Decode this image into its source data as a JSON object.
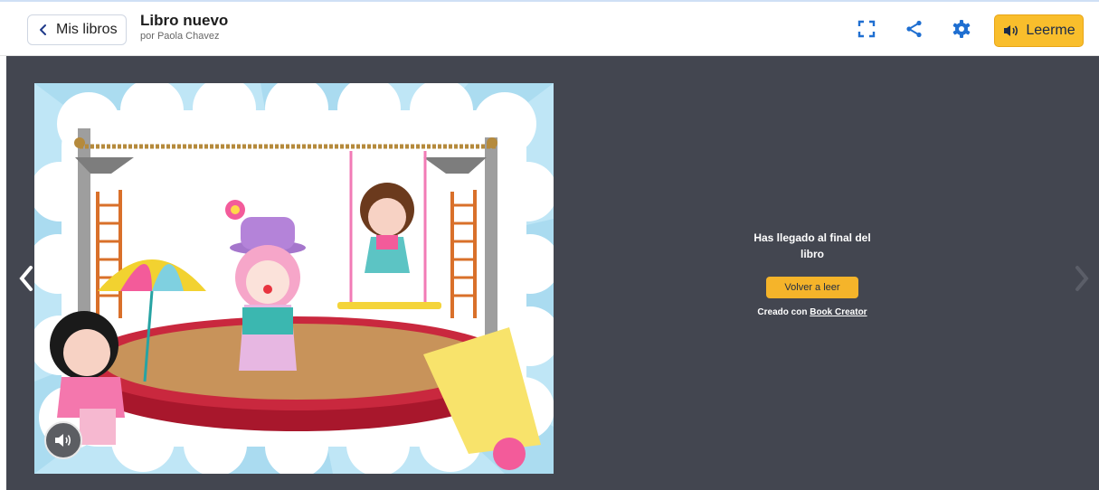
{
  "header": {
    "back_label": "Mis libros",
    "book_title": "Libro nuevo",
    "author": "por Paola Chavez",
    "read_aloud_label": "Leerme"
  },
  "end_panel": {
    "message": "Has llegado al final del libro",
    "read_again_label": "Volver a leer",
    "credit_prefix": "Creado con",
    "credit_link": "Book Creator"
  },
  "icons": [
    "chevron-left-icon",
    "fullscreen-icon",
    "share-icon",
    "gear-icon",
    "speaker-icon",
    "chevron-right-icon"
  ],
  "colors": {
    "accent_yellow": "#f9be2c",
    "icon_blue": "#1f6fd1",
    "stage_bg": "#434650"
  }
}
